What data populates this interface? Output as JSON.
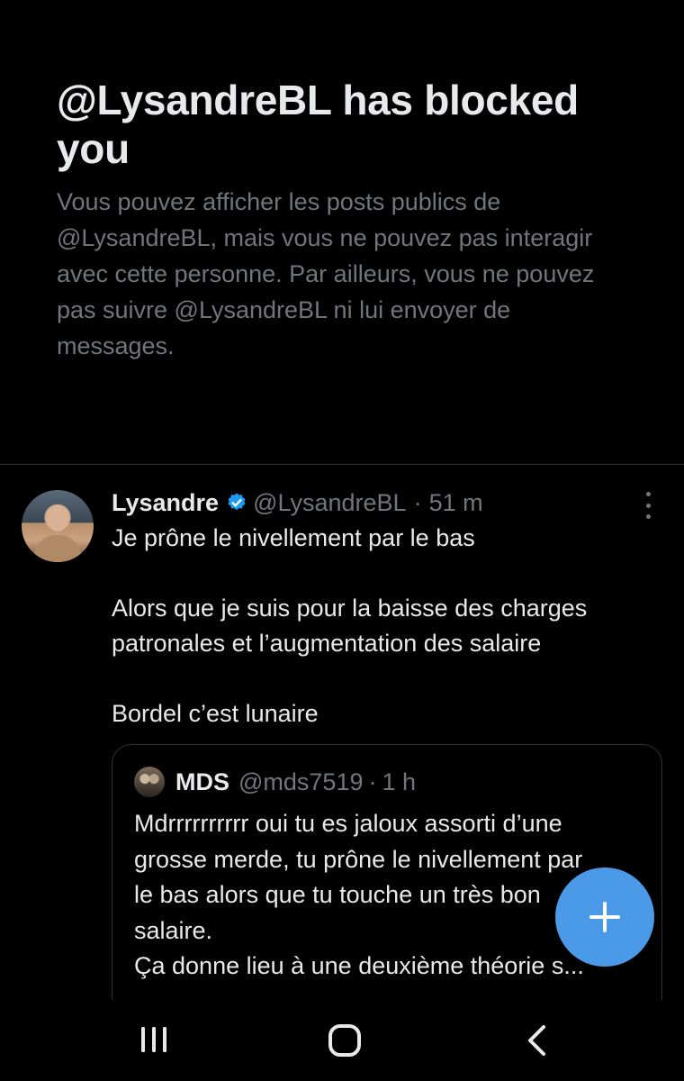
{
  "blocked_notice": {
    "title": "@LysandreBL has blocked you",
    "description": "Vous pouvez afficher les posts publics de @LysandreBL, mais vous ne pouvez pas interagir avec cette personne. Par ailleurs, vous ne pouvez pas suivre @LysandreBL ni lui envoyer de messages."
  },
  "tweet": {
    "author_name": "Lysandre",
    "verified_icon": "verified-badge-icon",
    "handle": "@LysandreBL",
    "separator": "·",
    "time": "51 m",
    "lines": [
      "Je prône le nivellement par le bas",
      "Alors que je suis pour la baisse des charges patronales et l’augmentation des salaire",
      "Bordel c’est lunaire"
    ]
  },
  "quote": {
    "author_name": "MDS",
    "handle": "@mds7519",
    "separator": "·",
    "time": "1 h",
    "lines": [
      "Mdrrrrrrrrrr oui tu es jaloux assorti d’une",
      "grosse merde, tu prône le nivellement par",
      "le bas alors que tu touche un très bon",
      "salaire.",
      "Ça donne lieu à une deuxième théorie s..."
    ]
  },
  "fab": {
    "icon": "plus-icon"
  },
  "navbar": {
    "icons": [
      "recent-apps-icon",
      "home-icon",
      "back-icon"
    ]
  },
  "colors": {
    "background": "#000000",
    "primary_text": "#e7e9ea",
    "secondary_text": "#71767b",
    "accent": "#4a9ae8",
    "verified": "#1d9bf0",
    "border": "#2f3336"
  }
}
